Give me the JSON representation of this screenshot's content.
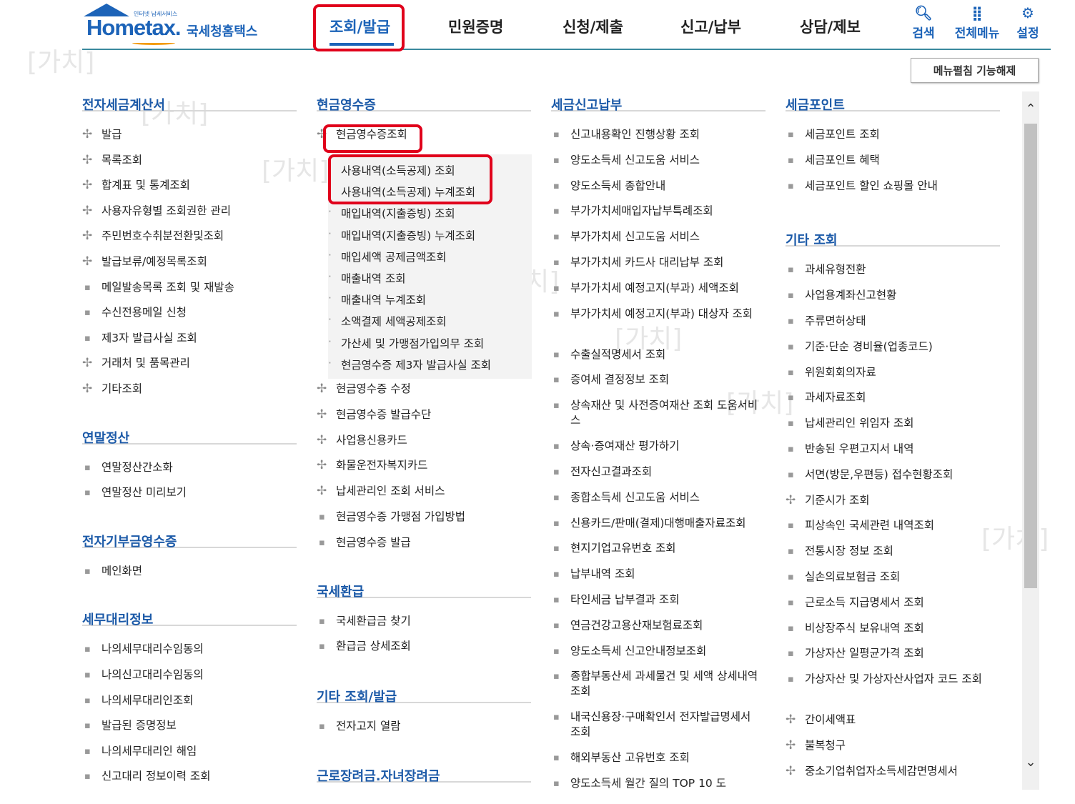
{
  "header": {
    "logo_tagline": "인터넷 납세서비스",
    "logo_word": "Hometax.",
    "logo_ko": "국세청홈택스",
    "nav": [
      "조회/발급",
      "민원증명",
      "신청/제출",
      "신고/납부",
      "상담/제보"
    ],
    "util": [
      {
        "label": "검색",
        "icon": "search-icon"
      },
      {
        "label": "전체메뉴",
        "icon": "grid-icon"
      },
      {
        "label": "설정",
        "icon": "gear-icon"
      }
    ],
    "accent": "#1c63b8"
  },
  "watermark": "[가치]",
  "edit_button": "메뉴펼침 기능해제",
  "col1": [
    {
      "title": "전자세금계산서",
      "items": [
        [
          "plus",
          "발급"
        ],
        [
          "plus",
          "목록조회"
        ],
        [
          "plus",
          "합계표 및 통계조회"
        ],
        [
          "plus",
          "사용자유형별 조회권한 관리"
        ],
        [
          "plus",
          "주민번호수취분전환및조회"
        ],
        [
          "plus",
          "발급보류/예정목록조회"
        ],
        [
          "dot",
          "메일발송목록 조회 및 재발송"
        ],
        [
          "dot",
          "수신전용메일 신청"
        ],
        [
          "dot",
          "제3자 발급사실 조회"
        ],
        [
          "plus",
          "거래처 및 품목관리"
        ],
        [
          "plus",
          "기타조회"
        ]
      ]
    },
    {
      "title": "연말정산",
      "items": [
        [
          "dot",
          "연말정산간소화"
        ],
        [
          "dot",
          "연말정산 미리보기"
        ]
      ]
    },
    {
      "title": "전자기부금영수증",
      "items": [
        [
          "dot",
          "메인화면"
        ]
      ]
    },
    {
      "title": "세무대리정보",
      "items": [
        [
          "dot",
          "나의세무대리수임동의"
        ],
        [
          "dot",
          "나의신고대리수임동의"
        ],
        [
          "dot",
          "나의세무대리인조회"
        ],
        [
          "dot",
          "발급된 증명정보"
        ],
        [
          "dot",
          "나의세무대리인 해임"
        ],
        [
          "dot",
          "신고대리 정보이력 조회"
        ]
      ]
    }
  ],
  "col2": {
    "title": "현금영수증",
    "first": "현금영수증조회",
    "sub": [
      "사용내역(소득공제) 조회",
      "사용내역(소득공제) 누계조회",
      "매입내역(지출증빙) 조회",
      "매입내역(지출증빙) 누계조회",
      "매입세액 공제금액조회",
      "매출내역 조회",
      "매출내역 누계조회",
      "소액결제 세액공제조회",
      "가산세 및 가맹점가입의무 조회",
      "현금영수증 제3자 발급사실 조회"
    ],
    "after": [
      [
        "plus",
        "현금영수증 수정"
      ],
      [
        "plus",
        "현금영수증 발급수단"
      ],
      [
        "plus",
        "사업용신용카드"
      ],
      [
        "plus",
        "화물운전자복지카드"
      ],
      [
        "plus",
        "납세관리인 조회 서비스"
      ],
      [
        "dot",
        "현금영수증 가맹점 가입방법"
      ],
      [
        "dot",
        "현금영수증 발급"
      ]
    ],
    "sections": [
      {
        "title": "국세환급",
        "items": [
          [
            "dot",
            "국세환급금 찾기"
          ],
          [
            "dot",
            "환급금 상세조회"
          ]
        ]
      },
      {
        "title": "기타 조회/발급",
        "items": [
          [
            "dot",
            "전자고지 열람"
          ]
        ]
      },
      {
        "title": "근로장려금.자녀장려금",
        "items": []
      }
    ]
  },
  "col3": {
    "title": "세금신고납부",
    "items": [
      "신고내용확인 진행상황 조회",
      "양도소득세 신고도움 서비스",
      "양도소득세 종합안내",
      "부가가치세매입자납부특례조회",
      "부가가치세 신고도움 서비스",
      "부가가치세 카드사 대리납부 조회",
      "부가가치세 예정고지(부과) 세액조회",
      "부가가치세 예정고지(부과) 대상자 조회",
      "수출실적명세서 조회",
      "증여세 결정정보 조회",
      "상속재산 및 사전증여재산 조회 도움서비스",
      "상속·증여재산 평가하기",
      "전자신고결과조회",
      "종합소득세 신고도움 서비스",
      "신용카드/판매(결제)대행매출자료조회",
      "현지기업고유번호 조회",
      "납부내역 조회",
      "타인세금 납부결과 조회",
      "연금건강고용산재보험료조회",
      "양도소득세 신고안내정보조회",
      "종합부동산세 과세물건 및 세액 상세내역 조회",
      "내국신용장·구매확인서 전자발급명세서 조회",
      "해외부동산 고유번호 조회",
      "양도소득세 월간 질의 TOP 10 도"
    ]
  },
  "col4": [
    {
      "title": "세금포인트",
      "items": [
        [
          "dot",
          "세금포인트 조회"
        ],
        [
          "dot",
          "세금포인트 혜택"
        ],
        [
          "dot",
          "세금포인트 할인 쇼핑몰 안내"
        ]
      ]
    },
    {
      "title": "기타 조회",
      "items": [
        [
          "dot",
          "과세유형전환"
        ],
        [
          "dot",
          "사업용계좌신고현황"
        ],
        [
          "dot",
          "주류면허상태"
        ],
        [
          "dot",
          "기준·단순 경비율(업종코드)"
        ],
        [
          "dot",
          "위원회회의자료"
        ],
        [
          "dot",
          "과세자료조회"
        ],
        [
          "dot",
          "납세관리인 위임자 조회"
        ],
        [
          "dot",
          "반송된 우편고지서 내역"
        ],
        [
          "dot",
          "서면(방문,우편등) 접수현황조회"
        ],
        [
          "plus",
          "기준시가 조회"
        ],
        [
          "dot",
          "피상속인 국세관련 내역조회"
        ],
        [
          "dot",
          "전통시장 정보 조회"
        ],
        [
          "dot",
          "실손의료보험금 조회"
        ],
        [
          "dot",
          "근로소득 지급명세서 조회"
        ],
        [
          "dot",
          "비상장주식 보유내역 조회"
        ],
        [
          "dot",
          "가상자산 일평균가격 조회"
        ],
        [
          "dot",
          "가상자산 및 가상자산사업자 코드 조회"
        ],
        [
          "plus",
          "간이세액표"
        ],
        [
          "plus",
          "불복청구"
        ],
        [
          "plus",
          "중소기업취업자소득세감면명세서"
        ]
      ]
    }
  ]
}
